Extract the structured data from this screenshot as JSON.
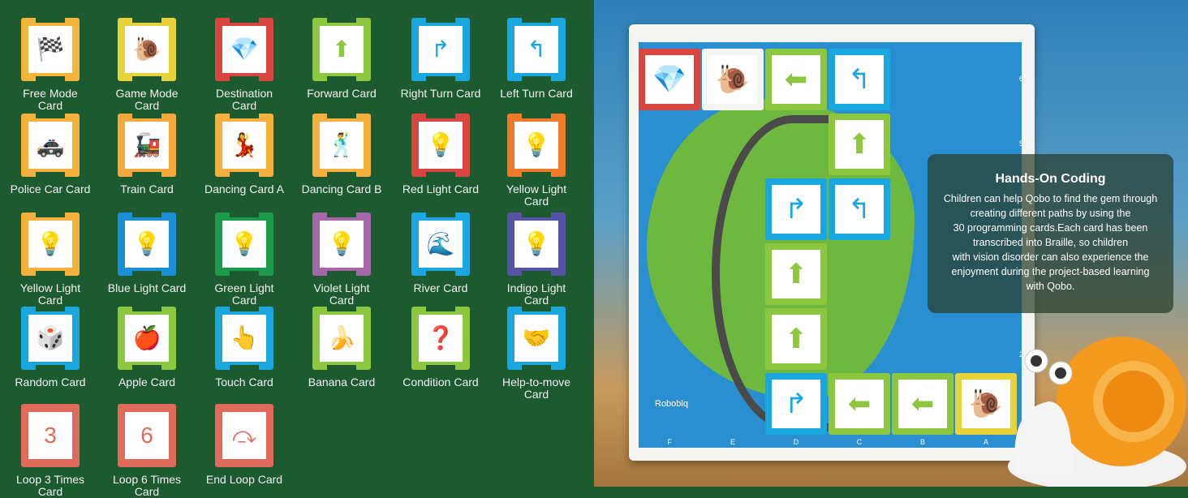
{
  "cards": [
    {
      "label": "Free Mode Card",
      "color": "#f3b53c",
      "icon": "start-sign-icon",
      "glyph": "🏁"
    },
    {
      "label": "Game Mode Card",
      "color": "#e8d33a",
      "icon": "snail-icon",
      "glyph": "🐌"
    },
    {
      "label": "Destination Card",
      "color": "#d9463f",
      "icon": "gem-icon",
      "glyph": "💎"
    },
    {
      "label": "Forward Card",
      "color": "#8dc63f",
      "icon": "arrow-up-icon",
      "glyph": "⬆"
    },
    {
      "label": "Right Turn Card",
      "color": "#1aa7e0",
      "icon": "arrow-right-turn-icon",
      "glyph": "↱"
    },
    {
      "label": "Left Turn Card",
      "color": "#1aa7e0",
      "icon": "arrow-left-turn-icon",
      "glyph": "↰"
    },
    {
      "label": "Police Car Card",
      "color": "#f6b13d",
      "icon": "police-car-icon",
      "glyph": "🚓"
    },
    {
      "label": "Train Card",
      "color": "#f4a93a",
      "icon": "train-icon",
      "glyph": "🚂"
    },
    {
      "label": "Dancing Card A",
      "color": "#f6b13d",
      "icon": "dancing-snail-icon",
      "glyph": "💃"
    },
    {
      "label": "Dancing Card B",
      "color": "#f6b13d",
      "icon": "dancing-snail-icon",
      "glyph": "🕺"
    },
    {
      "label": "Red Light Card",
      "color": "#d9463f",
      "icon": "bulb-icon",
      "glyph": "💡"
    },
    {
      "label": "Yellow Light Card",
      "color": "#ee7a2a",
      "icon": "bulb-icon",
      "glyph": "💡"
    },
    {
      "label": "Yellow Light Card",
      "color": "#f6b13d",
      "icon": "bulb-icon",
      "glyph": "💡"
    },
    {
      "label": "Blue Light Card",
      "color": "#1a8fd8",
      "icon": "bulb-icon",
      "glyph": "💡"
    },
    {
      "label": "Green Light Card",
      "color": "#1a9a4a",
      "icon": "bulb-icon",
      "glyph": "💡"
    },
    {
      "label": "Violet Light Card",
      "color": "#a667a8",
      "icon": "bulb-icon",
      "glyph": "💡"
    },
    {
      "label": "River Card",
      "color": "#1ca7e2",
      "icon": "river-icon",
      "glyph": "🌊"
    },
    {
      "label": "Indigo Light Card",
      "color": "#5553a5",
      "icon": "bulb-icon",
      "glyph": "💡"
    },
    {
      "label": "Random Card",
      "color": "#1aa7e0",
      "icon": "dice-icon",
      "glyph": "🎲"
    },
    {
      "label": "Apple Card",
      "color": "#8dc63f",
      "icon": "apple-icon",
      "glyph": "🍎"
    },
    {
      "label": "Touch Card",
      "color": "#1aa7e0",
      "icon": "touch-icon",
      "glyph": "👆"
    },
    {
      "label": "Banana Card",
      "color": "#8dc63f",
      "icon": "banana-icon",
      "glyph": "🍌"
    },
    {
      "label": "Condition Card",
      "color": "#8dc63f",
      "icon": "condition-icon",
      "glyph": "❓"
    },
    {
      "label": "Help-to-move Card",
      "color": "#1aa7e0",
      "icon": "help-icon",
      "glyph": "🤝"
    },
    {
      "label": "Loop 3 Times Card",
      "color": "#e06a5c",
      "icon": "loop-3-icon",
      "glyph": "3"
    },
    {
      "label": "Loop 6 Times Card",
      "color": "#e06a5c",
      "icon": "loop-6-icon",
      "glyph": "6"
    },
    {
      "label": "End Loop Card",
      "color": "#e06a5c",
      "icon": "end-loop-icon",
      "glyph": "⤼"
    }
  ],
  "board": {
    "columns": [
      "F",
      "E",
      "D",
      "C",
      "B",
      "A"
    ],
    "rows": [
      "6",
      "5",
      "2"
    ],
    "logo": "Roboblq",
    "placed": [
      {
        "col": 0,
        "row": 0,
        "color": "#d9463f",
        "glyph": "💎",
        "icon": "gem-icon"
      },
      {
        "col": 1,
        "row": 0,
        "color": "#f4f4f2",
        "glyph": "🐌",
        "icon": "snail-icon"
      },
      {
        "col": 2,
        "row": 0,
        "color": "#8dc63f",
        "glyph": "⬅",
        "icon": "arrow-left-icon"
      },
      {
        "col": 3,
        "row": 0,
        "color": "#1aa7e0",
        "glyph": "↰",
        "icon": "arrow-left-turn-icon"
      },
      {
        "col": 3,
        "row": 1,
        "color": "#8dc63f",
        "glyph": "⬆",
        "icon": "arrow-up-icon"
      },
      {
        "col": 2,
        "row": 2,
        "color": "#1aa7e0",
        "glyph": "↱",
        "icon": "arrow-right-turn-icon"
      },
      {
        "col": 3,
        "row": 2,
        "color": "#1aa7e0",
        "glyph": "↰",
        "icon": "arrow-left-turn-icon"
      },
      {
        "col": 2,
        "row": 3,
        "color": "#8dc63f",
        "glyph": "⬆",
        "icon": "arrow-up-icon"
      },
      {
        "col": 2,
        "row": 4,
        "color": "#8dc63f",
        "glyph": "⬆",
        "icon": "arrow-up-icon"
      },
      {
        "col": 2,
        "row": 5,
        "color": "#1aa7e0",
        "glyph": "↱",
        "icon": "arrow-right-turn-icon"
      },
      {
        "col": 3,
        "row": 5,
        "color": "#8dc63f",
        "glyph": "⬅",
        "icon": "arrow-left-icon"
      },
      {
        "col": 4,
        "row": 5,
        "color": "#8dc63f",
        "glyph": "⬅",
        "icon": "arrow-left-icon"
      },
      {
        "col": 5,
        "row": 5,
        "color": "#e8d33a",
        "glyph": "🐌",
        "icon": "snail-icon"
      }
    ]
  },
  "info": {
    "title": "Hands-On Coding",
    "lines": [
      "Children can help Qobo to find the gem through",
      "creating different paths by using the",
      "30 programming cards.Each card has been",
      "transcribed into Braille, so children",
      "with vision disorder can also experience the",
      "enjoyment during the project-based learning",
      "with Qobo."
    ]
  }
}
